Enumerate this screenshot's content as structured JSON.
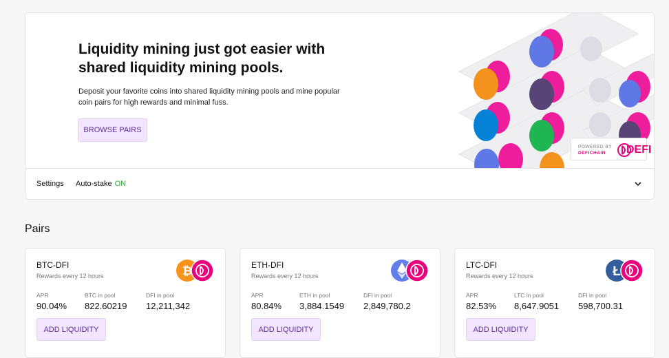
{
  "hero": {
    "title": "Liquidity mining just got easier with shared liquidity mining pools.",
    "description": "Deposit your favorite coins into shared liquidity mining pools and mine popular coin pairs for high rewards and minimal fuss.",
    "browse_button": "BROWSE PAIRS",
    "powered_by": "POWERED BY",
    "powered_brand": "DEFICHAIN",
    "powered_name": "DEFI"
  },
  "settings": {
    "label": "Settings",
    "autostake_label": "Auto-stake",
    "autostake_value": "ON"
  },
  "pairs_heading": "Pairs",
  "pairs": [
    {
      "name": "BTC-DFI",
      "rewards": "Rewards every 12 hours",
      "apr_label": "APR",
      "apr": "90.04%",
      "coin_label": "BTC in pool",
      "coin_value": "822.60219",
      "dfi_label": "DFI in pool",
      "dfi_value": "12,211,342",
      "button": "ADD LIQUIDITY",
      "coin_icon": "bitcoin-icon",
      "coin_color": "#f7931a"
    },
    {
      "name": "ETH-DFI",
      "rewards": "Rewards every 12 hours",
      "apr_label": "APR",
      "apr": "80.84%",
      "coin_label": "ETH in pool",
      "coin_value": "3,884.1549",
      "dfi_label": "DFI in pool",
      "dfi_value": "2,849,780.2",
      "button": "ADD LIQUIDITY",
      "coin_icon": "ethereum-icon",
      "coin_color": "#627eea"
    },
    {
      "name": "LTC-DFI",
      "rewards": "Rewards every 12 hours",
      "apr_label": "APR",
      "apr": "82.53%",
      "coin_label": "LTC in pool",
      "coin_value": "8,647.9051",
      "dfi_label": "DFI in pool",
      "dfi_value": "598,700.31",
      "button": "ADD LIQUIDITY",
      "coin_icon": "litecoin-icon",
      "coin_color": "#345d9d"
    }
  ],
  "colors": {
    "accent": "#e8007c",
    "button_bg": "#f1e5ff",
    "button_text": "#5b2d99",
    "on_green": "#2eaa3b"
  }
}
